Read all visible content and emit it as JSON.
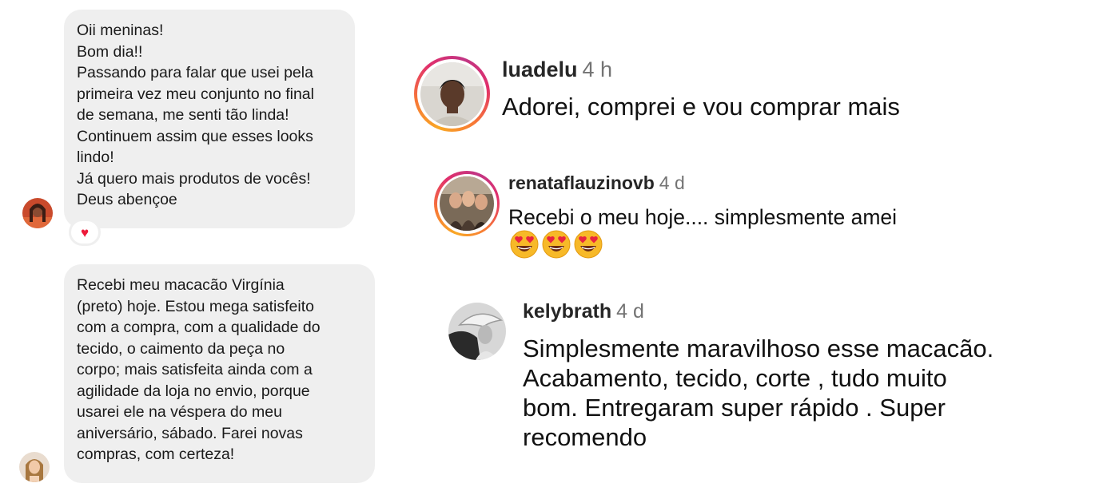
{
  "messages": [
    {
      "lines": [
        "Oii meninas!",
        "Bom dia!!",
        "Passando para falar que usei pela",
        "primeira vez meu conjunto no final",
        "de semana, me senti tão linda!",
        "Continuem assim que esses looks",
        "lindo!",
        "Já quero mais produtos de vocês!",
        "Deus abençoe"
      ],
      "reaction_icon": "heart-icon",
      "reaction_glyph": "♥",
      "reaction_color": "#ed1a3a"
    },
    {
      "lines": [
        "Recebi meu macacão Virgínia",
        "(preto)  hoje. Estou mega satisfeito",
        "com a compra, com a qualidade do",
        "tecido, o caimento da peça no",
        "corpo; mais satisfeita ainda com a",
        "agilidade da loja no envio, porque",
        "usarei ele na véspera do meu",
        "aniversário, sábado. Farei novas",
        "compras, com certeza!"
      ]
    }
  ],
  "comments": [
    {
      "username": "luadelu",
      "time": "4 h",
      "lines": [
        "Adorei, comprei e vou comprar mais"
      ],
      "story_ring": true
    },
    {
      "username": "renataflauzinovb",
      "time": "4 d",
      "lines": [
        "Recebi o meu hoje.... simplesmente amei"
      ],
      "emojis": [
        "heart-eyes-emoji",
        "heart-eyes-emoji",
        "heart-eyes-emoji"
      ],
      "story_ring": true
    },
    {
      "username": "kelybrath",
      "time": "4 d",
      "lines": [
        "Simplesmente maravilhoso esse macacão.",
        "Acabamento, tecido, corte , tudo muito",
        "bom. Entregaram super rápido . Super",
        "recomendo"
      ],
      "story_ring": false
    }
  ],
  "colors": {
    "bubble_background": "#efefef",
    "username": "#262626",
    "timestamp": "#737373",
    "story_ring_gradient": [
      "#f9a825",
      "#f77737",
      "#e1306c",
      "#c13584"
    ]
  }
}
